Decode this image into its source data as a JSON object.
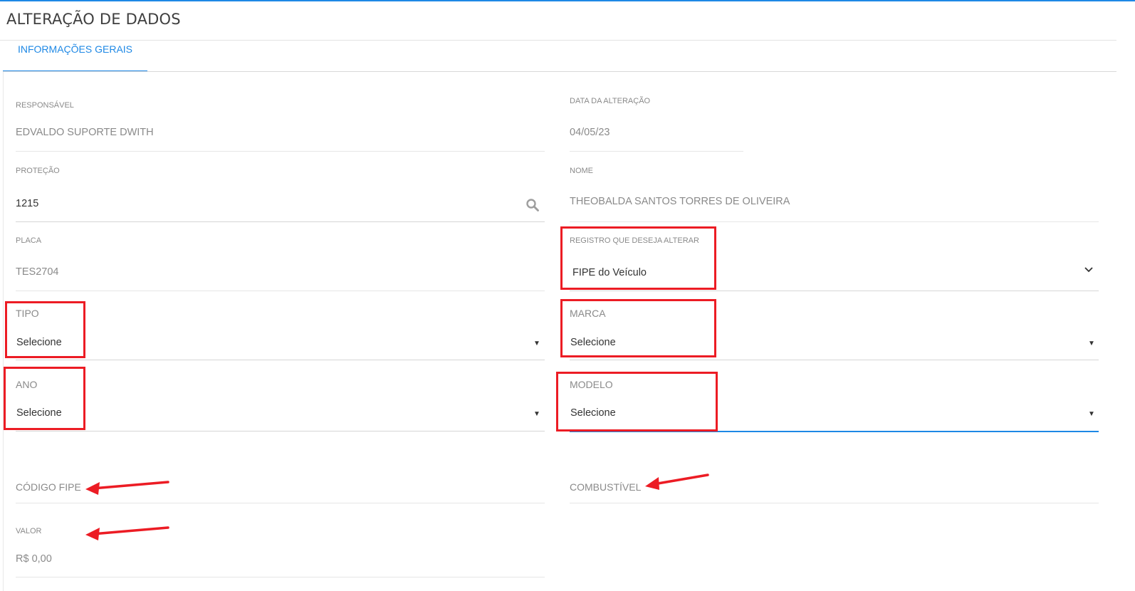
{
  "page": {
    "title": "ALTERAÇÃO DE DADOS"
  },
  "tabs": [
    {
      "label": "INFORMAÇÕES GERAIS",
      "active": true
    }
  ],
  "fields": {
    "responsavel": {
      "label": "RESPONSÁVEL",
      "value": "EDVALDO SUPORTE DWITH"
    },
    "data_alteracao": {
      "label": "DATA DA ALTERAÇÃO",
      "value": "04/05/23"
    },
    "protecao": {
      "label": "PROTEÇÃO",
      "value": "1215"
    },
    "nome": {
      "label": "NOME",
      "value": "THEOBALDA SANTOS TORRES DE OLIVEIRA"
    },
    "placa": {
      "label": "PLACA",
      "value": "TES2704"
    },
    "registro": {
      "label": "REGISTRO QUE DESEJA ALTERAR",
      "value": "FIPE do Veículo"
    },
    "tipo": {
      "label": "TIPO",
      "value": "Selecione"
    },
    "marca": {
      "label": "MARCA",
      "value": "Selecione"
    },
    "ano": {
      "label": "ANO",
      "value": "Selecione"
    },
    "modelo": {
      "label": "MODELO",
      "value": "Selecione"
    },
    "codigo_fipe": {
      "label": "CÓDIGO FIPE",
      "value": ""
    },
    "combustivel": {
      "label": "COMBUSTÍVEL",
      "value": ""
    },
    "valor": {
      "label": "VALOR",
      "value": "R$ 0,00"
    }
  },
  "icons": {
    "search": "search-icon",
    "select_caret": "caret-down-icon",
    "chevron": "chevron-down-icon"
  },
  "colors": {
    "accent": "#1e88e5",
    "annotation": "#ec1c24",
    "label": "#8a8a8a",
    "text": "#333333"
  }
}
